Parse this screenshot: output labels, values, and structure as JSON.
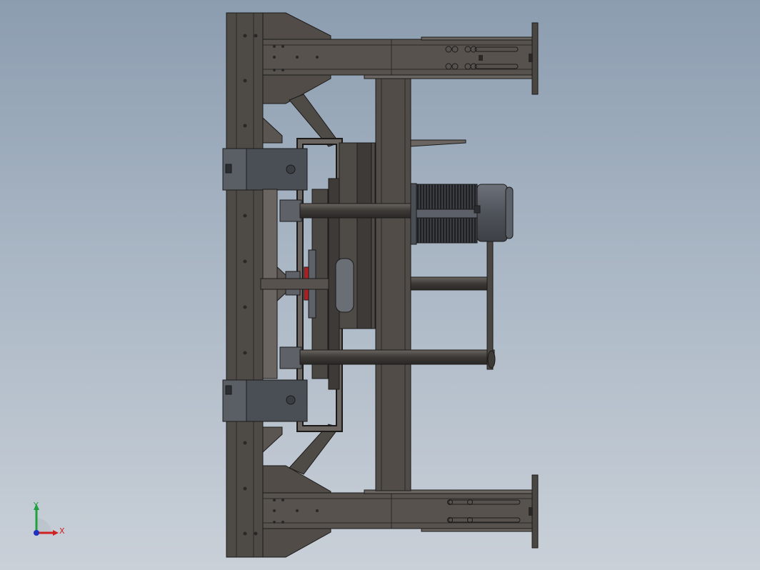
{
  "viewport": {
    "background_top": "#8c9db0",
    "background_bottom": "#c9d0d8",
    "model_color": "#4e4a46",
    "model_dark": "#3a3734",
    "model_light": "#66615c",
    "motor_color": "#5c6068",
    "accent_red": "#b02020"
  },
  "triad": {
    "x_label": "X",
    "y_label": "Y",
    "x_color": "#d02020",
    "y_color": "#20a040",
    "z_color": "#2030c0"
  }
}
